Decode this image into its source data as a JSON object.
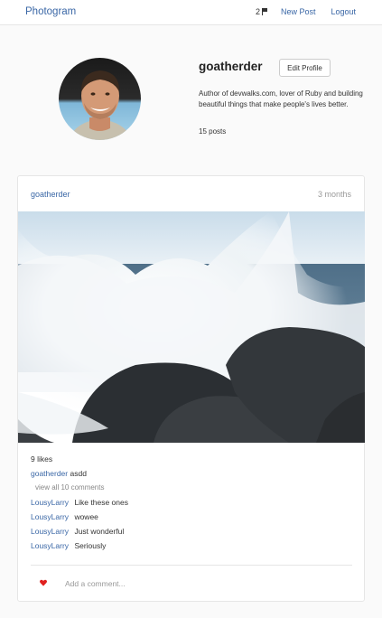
{
  "nav": {
    "brand": "Photogram",
    "notification_count": "2",
    "new_post": "New Post",
    "logout": "Logout"
  },
  "profile": {
    "username": "goatherder",
    "edit_label": "Edit Profile",
    "bio": "Author of devwalks.com, lover of Ruby and building beautiful things that make people's lives better.",
    "posts": "15 posts"
  },
  "post": {
    "user": "goatherder",
    "time": "3 months",
    "likes": "9 likes",
    "caption_user": "goatherder",
    "caption_text": "asdd",
    "view_all": "view all 10 comments",
    "comments": [
      {
        "user": "LousyLarry",
        "text": "Like these ones"
      },
      {
        "user": "LousyLarry",
        "text": "wowee"
      },
      {
        "user": "LousyLarry",
        "text": "Just wonderful"
      },
      {
        "user": "LousyLarry",
        "text": "Seriously"
      }
    ],
    "comment_placeholder": "Add a comment..."
  },
  "colors": {
    "link": "#3a67a6",
    "heart": "#e0201f"
  }
}
